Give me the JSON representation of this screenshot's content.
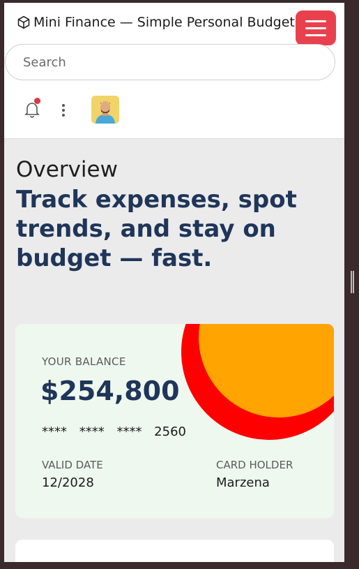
{
  "app": {
    "title": "Mini Finance — Simple Personal Budget",
    "menu_icon": "hamburger-icon",
    "brand_icon": "cube-icon",
    "accent": "#e8414d"
  },
  "header": {
    "search_placeholder": "Search",
    "notification_icon": "bell-icon",
    "more_icon": "vertical-dots-icon"
  },
  "hero": {
    "eyebrow": "Overview",
    "headline": "Track expenses, spot trends, and stay on budget — fast."
  },
  "card": {
    "balance_label": "YOUR BALANCE",
    "balance": "$254,800",
    "number": "****  ****  ****  2560",
    "valid_label": "VALID DATE",
    "valid_value": "12/2028",
    "holder_label": "CARD HOLDER",
    "holder_value": "Marzena",
    "colors": {
      "background": "#eff8ee",
      "circle_outer": "#ff0000",
      "circle_inner": "#ffa400",
      "text": "#1f3559"
    }
  }
}
